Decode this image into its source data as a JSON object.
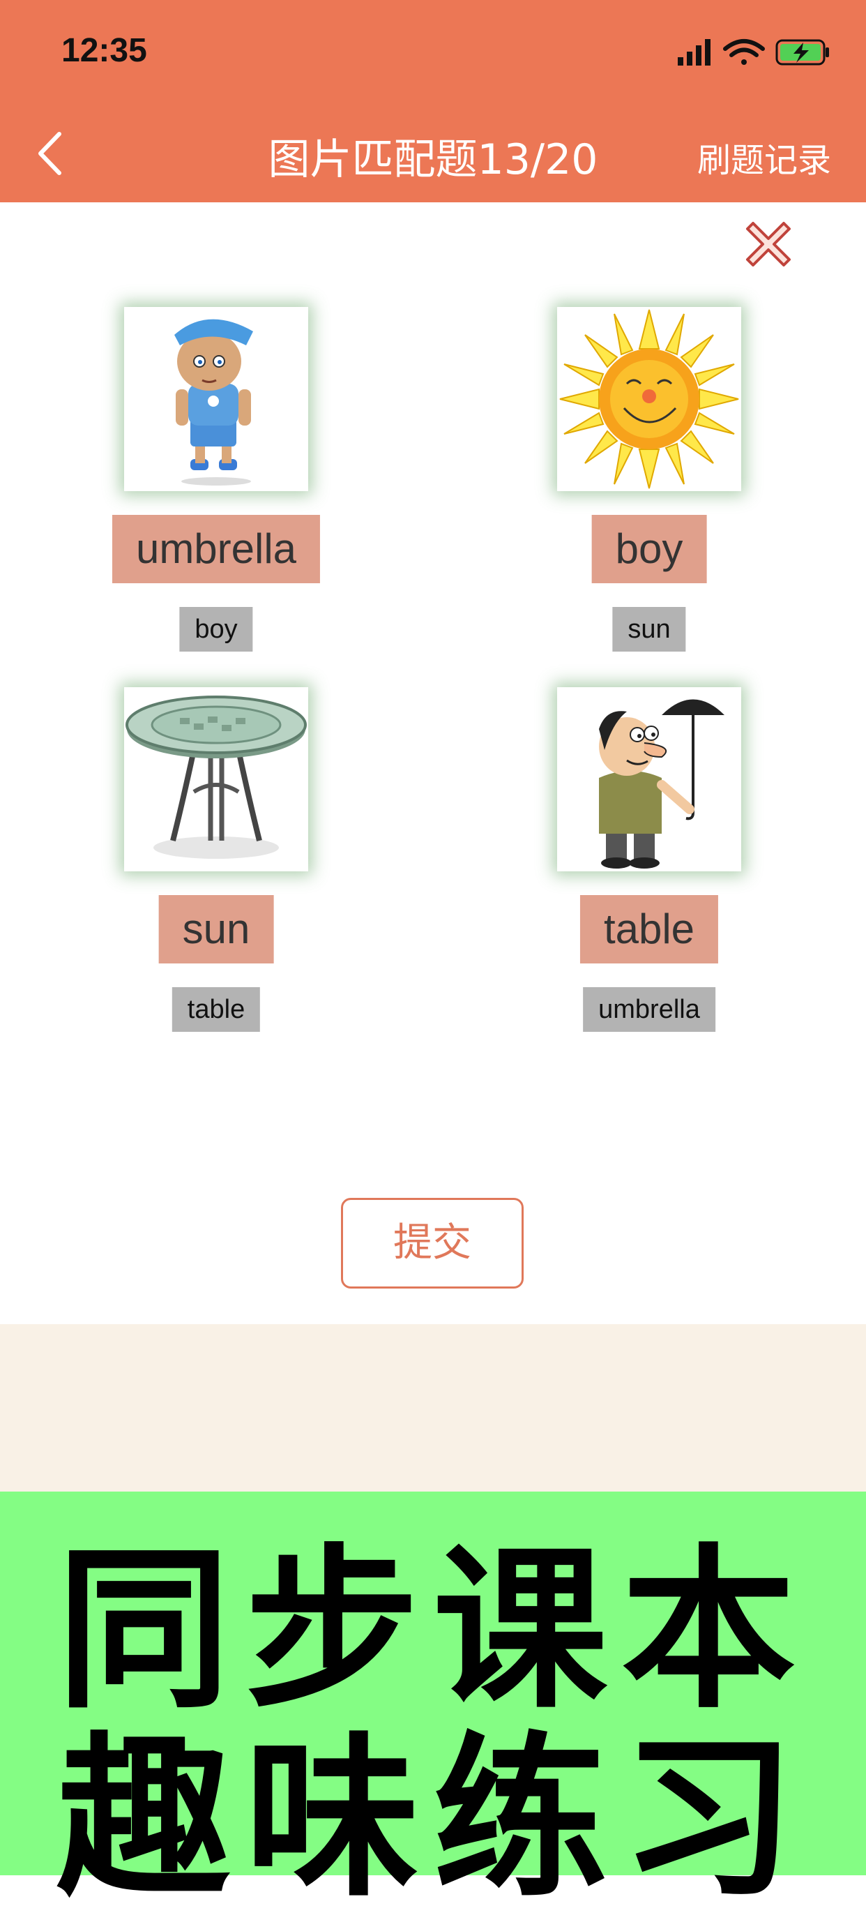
{
  "status": {
    "time": "12:35"
  },
  "nav": {
    "title": "图片匹配题13/20",
    "records": "刷题记录"
  },
  "cards": [
    {
      "image": "boy-cartoon",
      "answer": "umbrella",
      "word": "boy"
    },
    {
      "image": "sun-cartoon",
      "answer": "boy",
      "word": "sun"
    },
    {
      "image": "table-cartoon",
      "answer": "sun",
      "word": "table"
    },
    {
      "image": "man-umbrella-cartoon",
      "answer": "table",
      "word": "umbrella"
    }
  ],
  "submit_label": "提交",
  "promo": {
    "line1": "同步课本",
    "line2": "趣味练习"
  },
  "colors": {
    "header": "#EC7755",
    "answer_bg": "#E0A08C",
    "chip_bg": "#B3B3B3",
    "promo_bg": "#84FD84",
    "cream": "#F9F1E6"
  }
}
